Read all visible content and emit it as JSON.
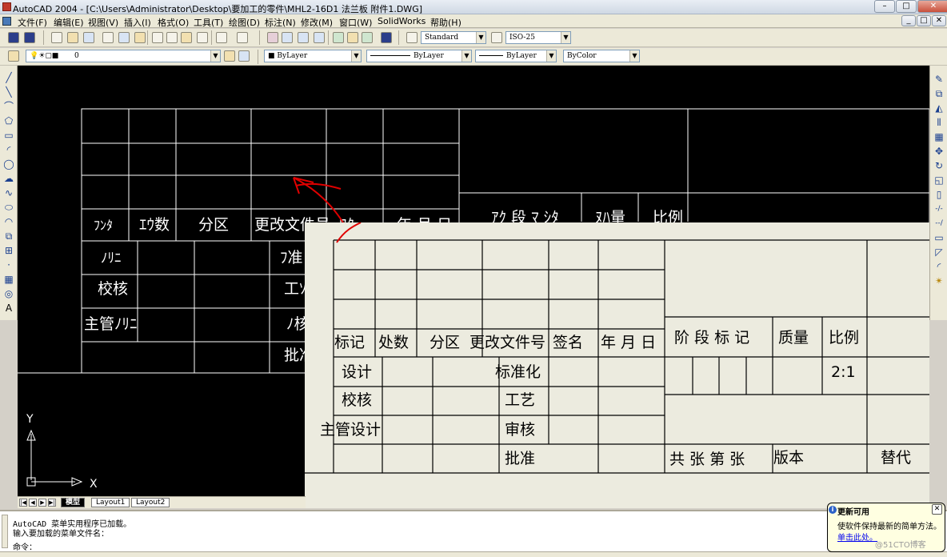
{
  "window": {
    "title": "AutoCAD 2004 - [C:\\Users\\Administrator\\Desktop\\要加工的零件\\MHL2-16D1 法兰板 附件1.DWG]",
    "minimize": "–",
    "restore": "□",
    "close": "✕",
    "doc_minimize": "_",
    "doc_restore": "□",
    "doc_close": "✕"
  },
  "menu": [
    "文件(F)",
    "编辑(E)",
    "视图(V)",
    "插入(I)",
    "格式(O)",
    "工具(T)",
    "绘图(D)",
    "标注(N)",
    "修改(M)",
    "窗口(W)",
    "SolidWorks",
    "帮助(H)"
  ],
  "toolbar": {
    "text_style": "Standard",
    "dim_style": "ISO-25",
    "layer": "0",
    "color": "ByLayer",
    "linetype": "ByLayer",
    "lineweight": "ByLayer",
    "plotstyle": "ByColor"
  },
  "left_toolbar_icons": [
    "line-icon",
    "construction-line-icon",
    "polyline-icon",
    "polygon-icon",
    "rectangle-icon",
    "arc-icon",
    "circle-icon",
    "revision-cloud-icon",
    "spline-icon",
    "ellipse-icon",
    "ellipse-arc-icon",
    "insert-block-icon",
    "make-block-icon",
    "point-icon",
    "hatch-icon",
    "region-icon",
    "multiline-text-icon"
  ],
  "left_toolbar_glyphs": [
    "╱",
    "╲",
    "⌒",
    "⬠",
    "▭",
    "◜",
    "◯",
    "☁",
    "∿",
    "⬭",
    "◠",
    "⧉",
    "⊞",
    "·",
    "▦",
    "◎",
    "A"
  ],
  "right_toolbar_icons": [
    "erase-icon",
    "copy-icon",
    "mirror-icon",
    "offset-icon",
    "array-icon",
    "move-icon",
    "rotate-icon",
    "scale-icon",
    "stretch-icon",
    "trim-icon",
    "extend-icon",
    "break-icon",
    "chamfer-icon",
    "fillet-icon",
    "explode-icon"
  ],
  "right_toolbar_glyphs": [
    "✎",
    "⧉",
    "◭",
    "⫴",
    "▦",
    "✥",
    "↻",
    "◱",
    "▯",
    "-/-",
    "--/",
    "▭",
    "◸",
    "◜",
    "✴"
  ],
  "cad_drawing": {
    "header_labels": [
      "ﾌﾝﾀ",
      "ｴｳ数",
      "分区",
      "更改文件号",
      "ﾜﾀ",
      "年 月 日"
    ],
    "right_labels": [
      "ｱｸ 段 ﾏ ｼﾀ",
      "ﾇﾊ量",
      "比例"
    ],
    "row_labels": [
      "ﾉﾘﾆ",
      "校核",
      "主管ﾉﾘﾆ"
    ],
    "mid_labels": [
      "ﾌ准",
      "工ｿ",
      "ﾉ核",
      "批准"
    ]
  },
  "overlay_table": {
    "header_labels": [
      "标记",
      "处数",
      "分区",
      "更改文件号",
      "签名",
      "年 月 日"
    ],
    "right_labels": [
      "阶 段 标 记",
      "质量",
      "比例"
    ],
    "scale_value": "2:1",
    "row_labels": [
      "设计",
      "校核",
      "主管设计"
    ],
    "mid_labels": [
      "标准化",
      "工艺",
      "审核",
      "批准"
    ],
    "footer_sheets": "共  张 第  张",
    "footer_version": "版本",
    "footer_replace": "替代"
  },
  "ucs": {
    "y_label": "Y",
    "x_label": "X"
  },
  "layout_tabs": [
    "模型",
    "Layout1",
    "Layout2"
  ],
  "tab_nav": [
    "|◀",
    "◀",
    "▶",
    "▶|"
  ],
  "command_lines": [
    "AutoCAD 菜单实用程序已加载。",
    "输入要加载的菜单文件名：",
    "命令："
  ],
  "balloon": {
    "title": "更新可用",
    "icon": "i",
    "close": "✕",
    "body": "使软件保持最新的简单方法。",
    "link": "单击此处。"
  },
  "watermark": "@51CTO博客"
}
